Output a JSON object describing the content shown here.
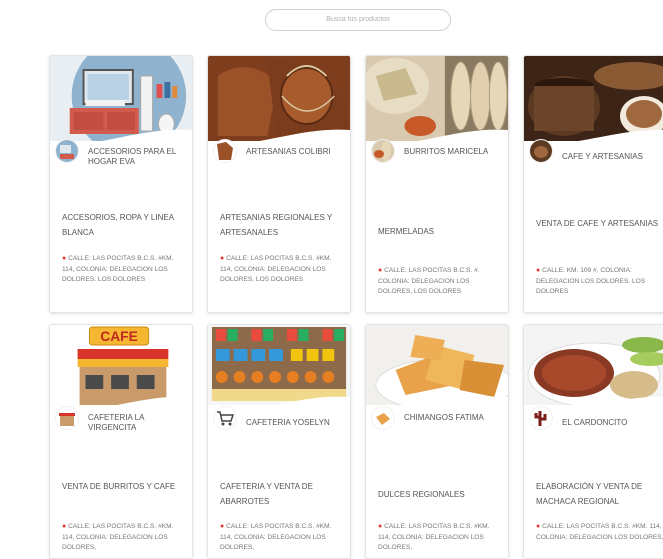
{
  "search": {
    "placeholder": "Busca tus productos"
  },
  "cards": [
    {
      "name": "ACCESORIOS PARA EL HOGAR EVA",
      "description": "ACCESORIOS, ROPA Y LINEA BLANCA",
      "address": "CALLE: LAS POCITAS B.C.S. #KM. 114, COLONIA: DELEGACION LOS DOLORES. LOS DOLORES"
    },
    {
      "name": "ARTESANIAS COLIBRI",
      "description": "ARTESANIAS REGIONALES Y ARTESANALES",
      "address": "CALLE: LAS POCITAS B.C.S. #KM. 114, COLONIA: DELEGACION LOS DOLORES. LOS DOLORES"
    },
    {
      "name": "BURRITOS MARICELA",
      "description": "MERMELADAS",
      "address": "CALLE: LAS POCITAS B.C.S. #. COLONIA: DELEGACION LOS DOLORES, LOS DOLORES"
    },
    {
      "name": "CAFE Y ARTESANIAS",
      "description": "VENTA DE CAFE Y ARTESANIAS",
      "address": "CALLE: KM. 109 #, COLONIA: DELEGACION LOS DOLORES. LOS DOLORES"
    },
    {
      "name": "CAFETERIA LA VIRGENCITA",
      "description": "VENTA DE BURRITOS Y CAFE",
      "address": "CALLE: LAS POCITAS B.C.S. #KM. 114, COLONIA: DELEGACION LOS DOLORES,"
    },
    {
      "name": "CAFETERIA YOSELYN",
      "description": "CAFETERIA Y VENTA DE ABARROTES",
      "address": "CALLE: LAS POCITAS B.C.S. #KM. 114, COLONIA: DELEGACION LOS DOLORES,"
    },
    {
      "name": "CHIMANGOS FATIMA",
      "description": "DULCES REGIONALES",
      "address": "CALLE: LAS POCITAS B.C.S. #KM. 114, COLONIA: DELEGACION LOS DOLORES,"
    },
    {
      "name": "EL CARDONCITO",
      "description": "ELABORACIÓN Y VENTA DE MACHACA REGIONAL",
      "address": "CALLE: LAS POCITAS B.C.S. #KM. 114, COLONIA: DELEGACION LOS DOLORES,"
    }
  ],
  "hero_labels": {
    "cafe_sign": "CAFE"
  },
  "colors": {
    "pin": "#e53935",
    "card_border": "#e4e4e4"
  }
}
